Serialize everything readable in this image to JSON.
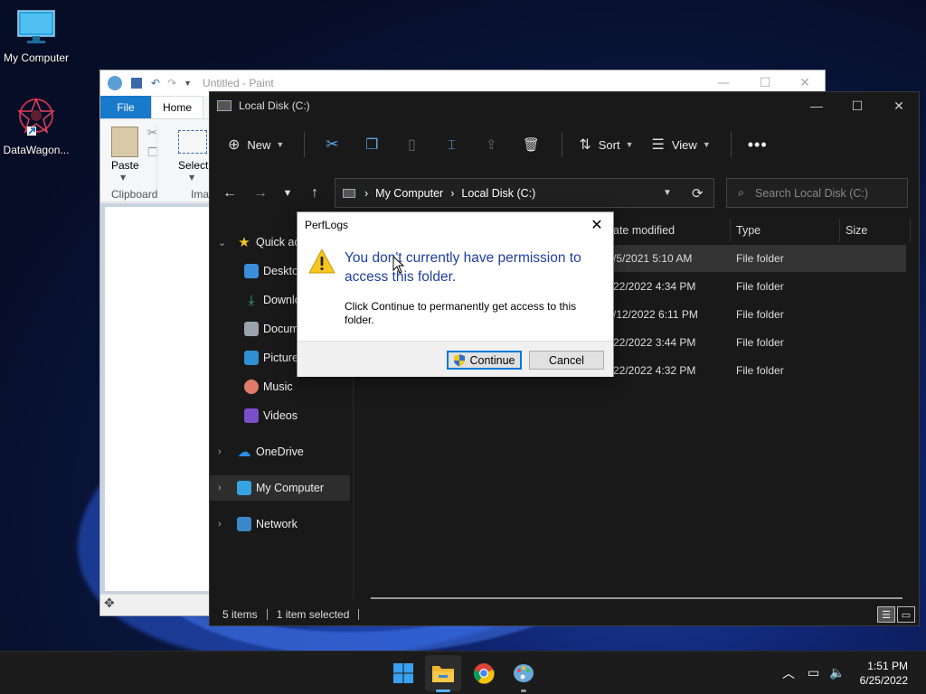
{
  "desktop": {
    "icons": [
      {
        "label": "My Computer"
      },
      {
        "label": "DataWagon..."
      }
    ]
  },
  "paint": {
    "title": "Untitled - Paint",
    "tabs": {
      "file": "File",
      "home": "Home"
    },
    "ribbon": {
      "paste": "Paste",
      "select": "Select",
      "image_partial": "Imag",
      "clipboard": "Clipboard"
    }
  },
  "explorer": {
    "title": "Local Disk (C:)",
    "toolbar": {
      "new": "New",
      "sort": "Sort",
      "view": "View"
    },
    "breadcrumb": [
      "My Computer",
      "Local Disk (C:)"
    ],
    "search_placeholder": "Search Local Disk (C:)",
    "columns": {
      "date": "ate modified",
      "type": "Type",
      "size": "Size"
    },
    "sidebar": [
      {
        "label": "Quick ac"
      },
      {
        "label": "Desktop"
      },
      {
        "label": "Downlo"
      },
      {
        "label": "Docum"
      },
      {
        "label": "Picture"
      },
      {
        "label": "Music"
      },
      {
        "label": "Videos"
      },
      {
        "label": "OneDrive"
      },
      {
        "label": "My Computer"
      },
      {
        "label": "Network"
      }
    ],
    "rows": [
      {
        "date": "/5/2021 5:10 AM",
        "type": "File folder"
      },
      {
        "date": "22/2022 4:34 PM",
        "type": "File folder"
      },
      {
        "date": "/12/2022 6:11 PM",
        "type": "File folder"
      },
      {
        "date": "22/2022 3:44 PM",
        "type": "File folder"
      },
      {
        "date": "22/2022 4:32 PM",
        "type": "File folder"
      }
    ],
    "status": {
      "items": "5 items",
      "selected": "1 item selected"
    }
  },
  "dialog": {
    "title": "PerfLogs",
    "main_text": "You don't currently have permission to access this folder.",
    "sub_text": "Click Continue to permanently get access to this folder.",
    "continue": "Continue",
    "cancel": "Cancel"
  },
  "taskbar": {
    "time": "1:51 PM",
    "date": "6/25/2022"
  },
  "colors": {
    "accent": "#0078d7",
    "dialog_heading": "#1f3fa0",
    "explorer_bg": "#191919"
  }
}
